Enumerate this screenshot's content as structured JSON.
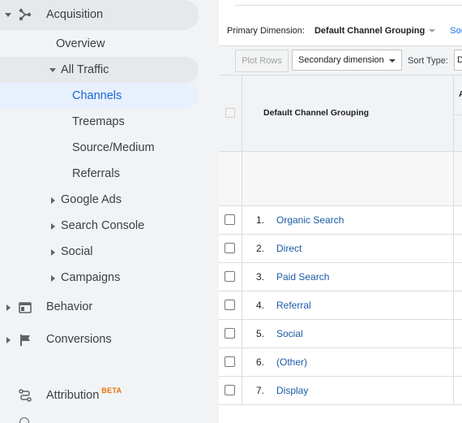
{
  "sidebar": {
    "acquisition_label": "Acquisition",
    "overview_label": "Overview",
    "all_traffic_label": "All Traffic",
    "channels_label": "Channels",
    "treemaps_label": "Treemaps",
    "source_medium_label": "Source/Medium",
    "referrals_label": "Referrals",
    "google_ads_label": "Google Ads",
    "search_console_label": "Search Console",
    "social_label": "Social",
    "campaigns_label": "Campaigns",
    "behavior_label": "Behavior",
    "conversions_label": "Conversions",
    "attribution_label": "Attribution",
    "beta_badge": "BETA"
  },
  "report": {
    "primary_dimension_label": "Primary Dimension:",
    "primary_dimension_value": "Default Channel Grouping",
    "source_link": "Sourc",
    "plot_rows_label": "Plot Rows",
    "secondary_dimension_label": "Secondary dimension",
    "sort_type_label": "Sort Type:",
    "sort_type_value": "D",
    "column_header": "Default Channel Grouping",
    "next_column_header_partial": "A",
    "rows": [
      {
        "num": "1.",
        "name": "Organic Search"
      },
      {
        "num": "2.",
        "name": "Direct"
      },
      {
        "num": "3.",
        "name": "Paid Search"
      },
      {
        "num": "4.",
        "name": "Referral"
      },
      {
        "num": "5.",
        "name": "Social"
      },
      {
        "num": "6.",
        "name": "(Other)"
      },
      {
        "num": "7.",
        "name": "Display"
      }
    ]
  },
  "colors": {
    "sidebar_bg": "#f1f3f4",
    "active_highlight": "#e8f0fe",
    "active_text": "#1967d2",
    "group_highlight": "#e6e8ea",
    "link": "#1a5aa5",
    "beta": "#e8710a"
  }
}
